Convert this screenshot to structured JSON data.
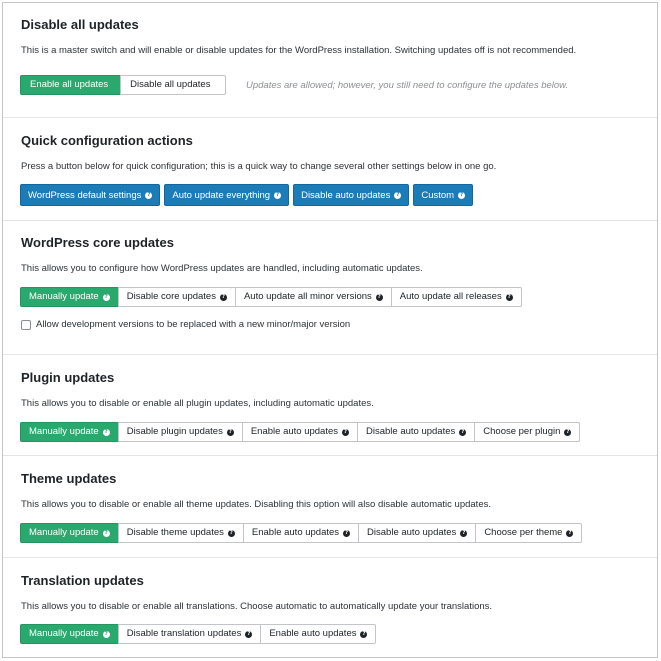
{
  "sections": {
    "master": {
      "title": "Disable all updates",
      "description": "This is a master switch and will enable or disable updates for the WordPress installation. Switching updates off is not recommended.",
      "buttons": [
        "Enable all updates",
        "Disable all updates"
      ],
      "active": "Enable all updates",
      "note": "Updates are allowed; however, you still need to configure the updates below."
    },
    "quick": {
      "title": "Quick configuration actions",
      "description": "Press a button below for quick configuration; this is a quick way to change several other settings below in one go.",
      "buttons": [
        "WordPress default settings",
        "Auto update everything",
        "Disable auto updates",
        "Custom"
      ]
    },
    "core": {
      "title": "WordPress core updates",
      "description": "This allows you to configure how WordPress updates are handled, including automatic updates.",
      "buttons": [
        "Manually update",
        "Disable core updates",
        "Auto update all minor versions",
        "Auto update all releases"
      ],
      "active": "Manually update",
      "checkbox_label": "Allow development versions to be replaced with a new minor/major version"
    },
    "plugin": {
      "title": "Plugin updates",
      "description": "This allows you to disable or enable all plugin updates, including automatic updates.",
      "buttons": [
        "Manually update",
        "Disable plugin updates",
        "Enable auto updates",
        "Disable auto updates",
        "Choose per plugin"
      ],
      "active": "Manually update"
    },
    "theme": {
      "title": "Theme updates",
      "description": "This allows you to disable or enable all theme updates. Disabling this option will also disable automatic updates.",
      "buttons": [
        "Manually update",
        "Disable theme updates",
        "Enable auto updates",
        "Disable auto updates",
        "Choose per theme"
      ],
      "active": "Manually update"
    },
    "translation": {
      "title": "Translation updates",
      "description": "This allows you to disable or enable all translations. Choose automatic to automatically update your translations.",
      "buttons": [
        "Manually update",
        "Disable translation updates",
        "Enable auto updates"
      ],
      "active": "Manually update"
    }
  },
  "help_glyph": "?",
  "colors": {
    "active_green": "#2aa96e",
    "quick_blue": "#1c7cb8"
  }
}
